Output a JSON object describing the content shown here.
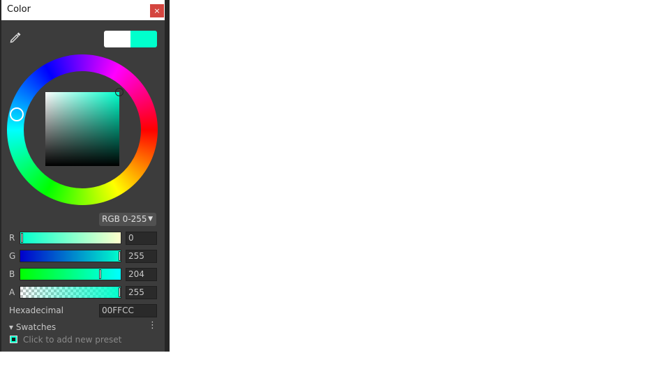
{
  "window": {
    "title": "Color",
    "close_label": "×"
  },
  "color": {
    "current_hex": "#00ffcc",
    "previous_hex": "#ffffff"
  },
  "mode": {
    "selected": "RGB 0-255",
    "arrow": "▼"
  },
  "channels": [
    {
      "label": "R",
      "value": "0",
      "fraction": 0.0
    },
    {
      "label": "G",
      "value": "255",
      "fraction": 1.0
    },
    {
      "label": "B",
      "value": "204",
      "fraction": 0.8
    },
    {
      "label": "A",
      "value": "255",
      "fraction": 1.0
    }
  ],
  "hex": {
    "label": "Hexadecimal",
    "value": "00FFCC"
  },
  "swatches": {
    "toggle_label": "▾ Swatches",
    "menu_label": "⋮",
    "hint": "Click to add new preset"
  },
  "icons": {
    "eyedropper": "eyedropper-icon",
    "options": "kebab-menu-icon",
    "collapse": "triangle-down-icon"
  }
}
